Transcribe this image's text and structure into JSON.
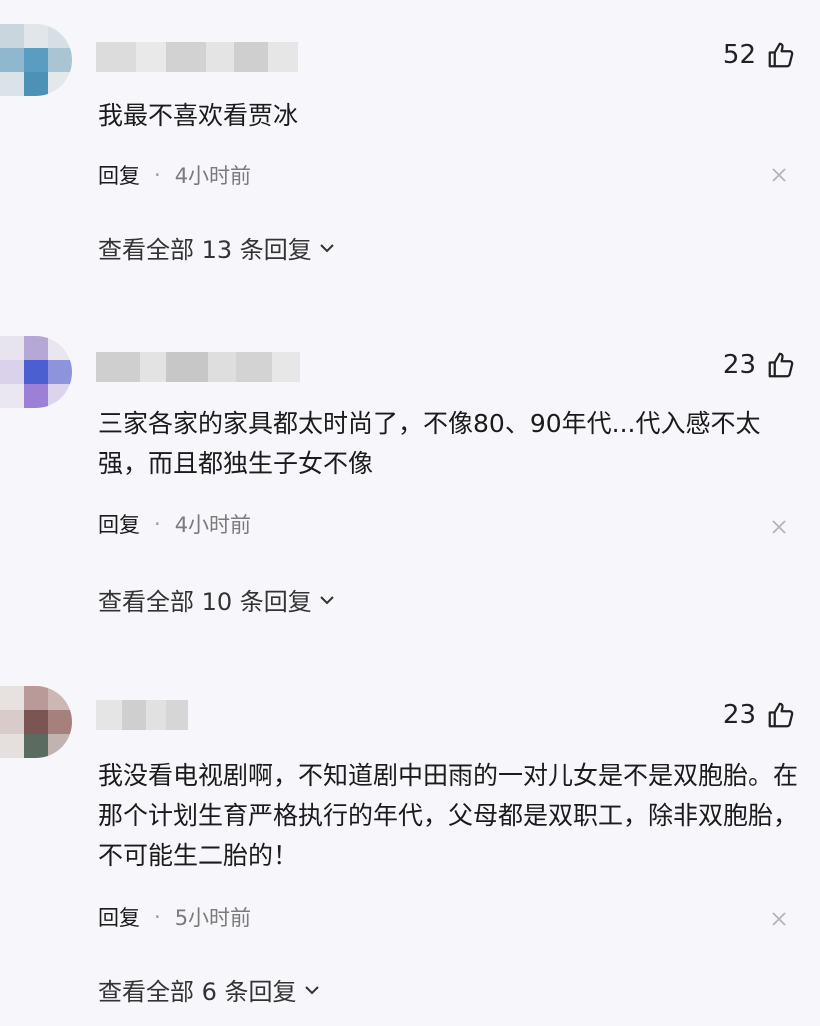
{
  "comments": [
    {
      "likes": "52",
      "text": "我最不喜欢看贾冰",
      "reply_label": "回复",
      "dot": "·",
      "time": "4小时前",
      "view_replies": "查看全部 13 条回复"
    },
    {
      "likes": "23",
      "text": "三家各家的家具都太时尚了，不像80、90年代...代入感不太强，而且都独生子女不像",
      "reply_label": "回复",
      "dot": "·",
      "time": "4小时前",
      "view_replies": "查看全部 10 条回复"
    },
    {
      "likes": "23",
      "text": "我没看电视剧啊，不知道剧中田雨的一对儿女是不是双胞胎。在那个计划生育严格执行的年代，父母都是双职工，除非双胞胎，不可能生二胎的！",
      "reply_label": "回复",
      "dot": "·",
      "time": "5小时前",
      "view_replies": "查看全部 6 条回复"
    }
  ],
  "icons": {
    "like": "thumbs-up-icon",
    "close": "close-icon",
    "chevron": "chevron-down-icon"
  },
  "colors": {
    "background": "#f6f6fb",
    "text": "#1b1b1b",
    "muted": "#7b7b7b"
  }
}
